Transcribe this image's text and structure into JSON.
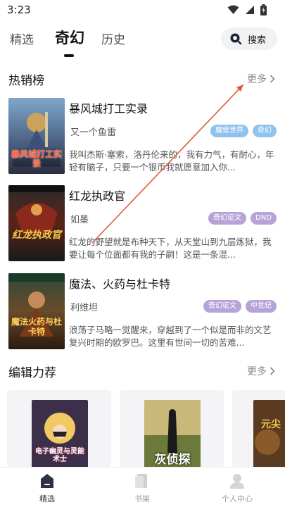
{
  "status_bar": {
    "time": "3:23"
  },
  "top_tabs": [
    {
      "label": "精选",
      "active": false
    },
    {
      "label": "奇幻",
      "active": true
    },
    {
      "label": "历史",
      "active": false
    }
  ],
  "search": {
    "label": "搜索",
    "icon": "search-icon"
  },
  "bestsellers": {
    "title": "热销榜",
    "more": "更多",
    "books": [
      {
        "title": "暴风城打工实录",
        "author": "又一个鱼雷",
        "tags": [
          "魔兽世界",
          "奇幻"
        ],
        "tag_colors": [
          "#8fc3ee",
          "#8fc3ee"
        ],
        "desc": "我叫杰斯·塞索，洛丹伦来的，我有力气，有耐心，年轻有脑子，只要一个银币我就愿意加入你...",
        "cover_text": "暴风城打工实录"
      },
      {
        "title": "红龙执政官",
        "author": "如墨",
        "tags": [
          "奇幻征文",
          "DND"
        ],
        "tag_colors": [
          "#b7a3d8",
          "#b7a3d8"
        ],
        "desc": "红龙的野望就是布种天下，从天堂山到九层炼狱，我要让每个位面都有我的子嗣！这是一条混...",
        "cover_text": "红龙执政官"
      },
      {
        "title": "魔法、火药与杜卡特",
        "author": "利维坦",
        "tags": [
          "奇幻征文",
          "中世纪"
        ],
        "tag_colors": [
          "#b7a3d8",
          "#b7a3d8"
        ],
        "desc": "浪荡子马略一觉醒来，穿越到了一个似是而非的文艺复兴时期的欧罗巴。这里有世间一切的苦难...",
        "cover_text": "魔法火药与杜卡特"
      }
    ]
  },
  "editor_picks": {
    "title": "编辑力荐",
    "more": "更多",
    "covers": [
      "电子幽灵与灵能术士",
      "灰侦探",
      "元尖"
    ]
  },
  "bottom_nav": [
    {
      "label": "精选",
      "icon": "home-icon",
      "active": true
    },
    {
      "label": "书架",
      "icon": "bookshelf-icon",
      "active": false
    },
    {
      "label": "个人中心",
      "icon": "profile-icon",
      "active": false
    }
  ],
  "colors": {
    "tag_blue": "#8fc3ee",
    "tag_purple": "#b7a3d8",
    "annotation_arrow": "#e05a3c"
  }
}
